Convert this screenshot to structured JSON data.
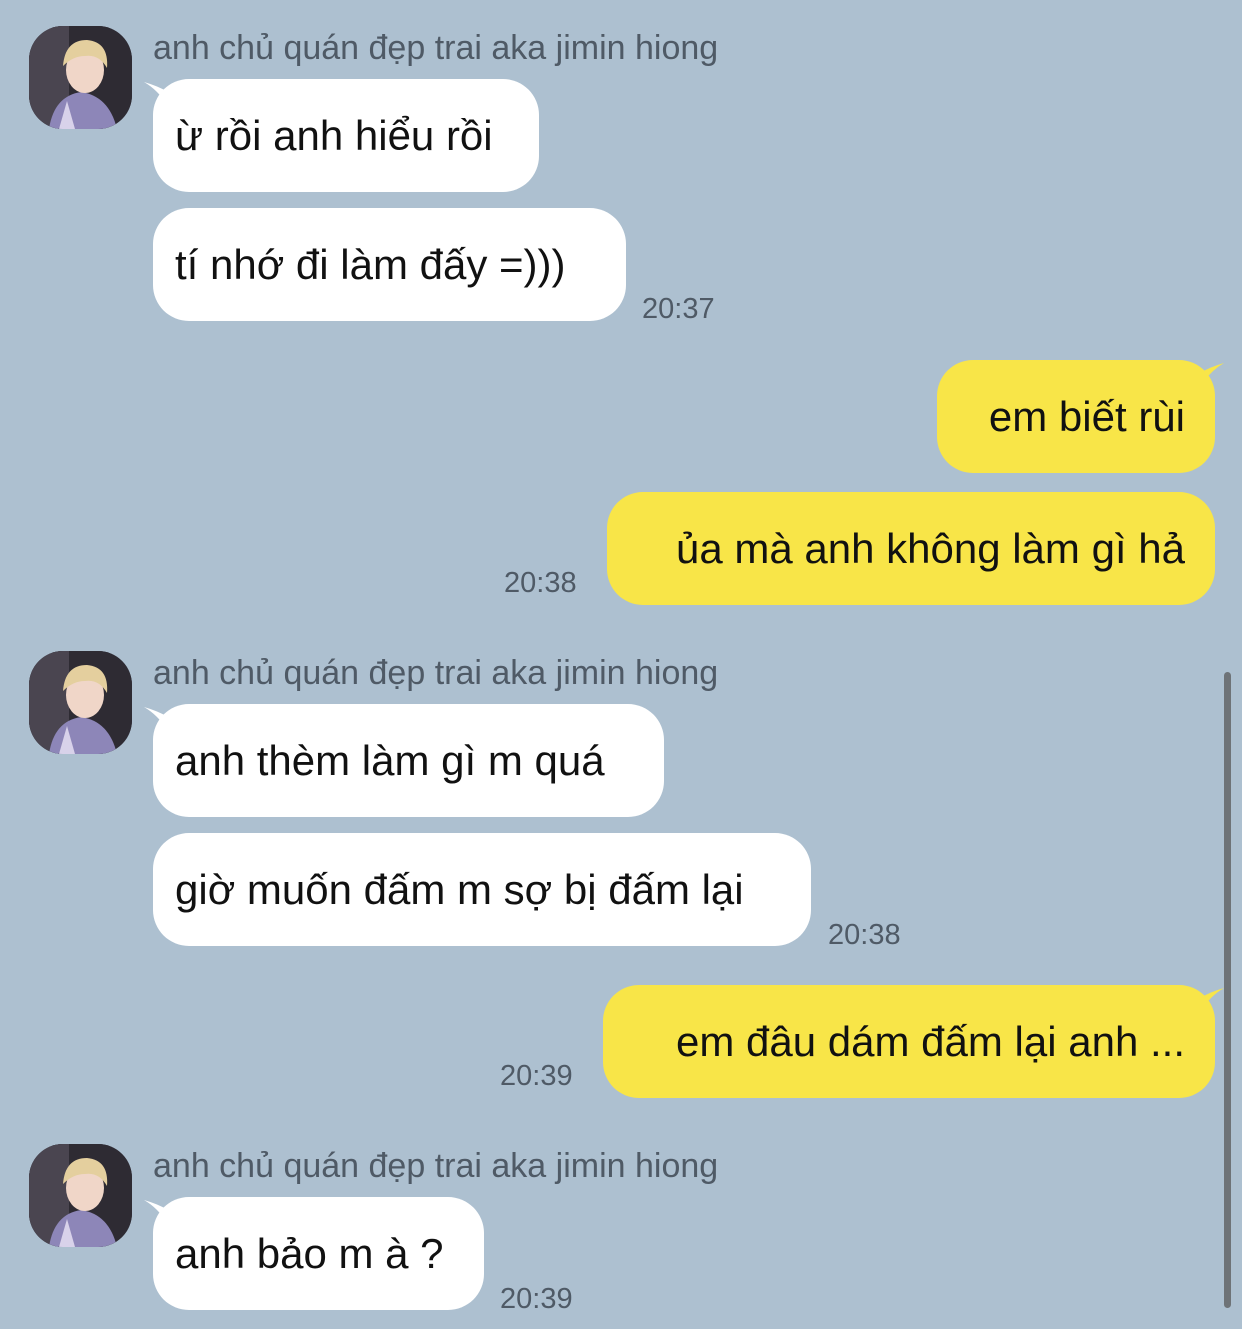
{
  "colors": {
    "background": "#adc0d0",
    "incoming_bubble": "#ffffff",
    "outgoing_bubble": "#f8e548",
    "meta_text": "#4f5a66"
  },
  "avatar_icon": "profile-photo",
  "group1": {
    "sender": "anh chủ quán đẹp trai aka jimin hiong",
    "msg1": "ừ rồi anh hiểu rồi",
    "msg2": "tí nhớ đi làm đấy =)))",
    "time": "20:37"
  },
  "group2": {
    "msg1": "em biết rùi",
    "msg2": "ủa mà anh không làm gì hả",
    "time": "20:38"
  },
  "group3": {
    "sender": "anh chủ quán đẹp trai aka jimin hiong",
    "msg1": "anh thèm làm gì m quá",
    "msg2": "giờ muốn đấm m sợ bị đấm lại",
    "time": "20:38"
  },
  "group4": {
    "msg1": "em đâu dám đấm lại anh ...",
    "time": "20:39"
  },
  "group5": {
    "sender": "anh chủ quán đẹp trai aka jimin hiong",
    "msg1": "anh bảo m à ?",
    "time": "20:39"
  }
}
